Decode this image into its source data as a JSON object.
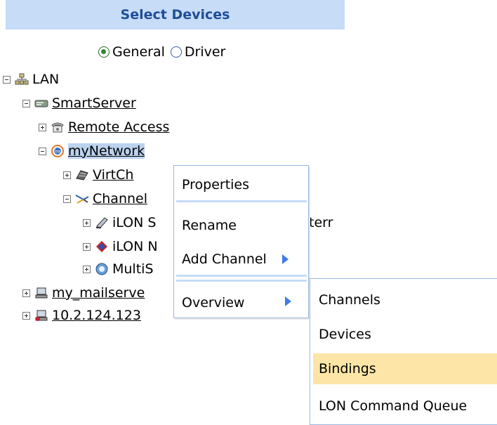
{
  "panel": {
    "title": "Select Devices"
  },
  "view_mode": {
    "options": [
      {
        "label": "General",
        "selected": true
      },
      {
        "label": "Driver",
        "selected": false
      }
    ]
  },
  "tree": {
    "lan": "LAN",
    "smartserver": "SmartServer",
    "remote_access": "Remote Access",
    "mynetwork": "myNetwork",
    "virtch": "VirtCh",
    "channel": "Channel",
    "ilon_s": "iLON S",
    "ilon_s_suffix": "terr",
    "ilon_n": "iLON N",
    "multis": "MultiS",
    "my_mailserver": "my_mailserve",
    "ip_device": "10.2.124.123"
  },
  "context_menu": {
    "items": [
      "Properties",
      "Rename",
      "Add Channel",
      "Overview"
    ]
  },
  "submenu": {
    "items": [
      "Channels",
      "Devices",
      "Bindings",
      "LON Command Queue"
    ],
    "highlighted": "Bindings"
  },
  "colors": {
    "header_bg": "#c6dcf7",
    "header_text": "#1f4e96",
    "selected_node_bg": "#bcd3ef",
    "submenu_hover": "#fce5a6",
    "arrow": "#3f7be8"
  }
}
